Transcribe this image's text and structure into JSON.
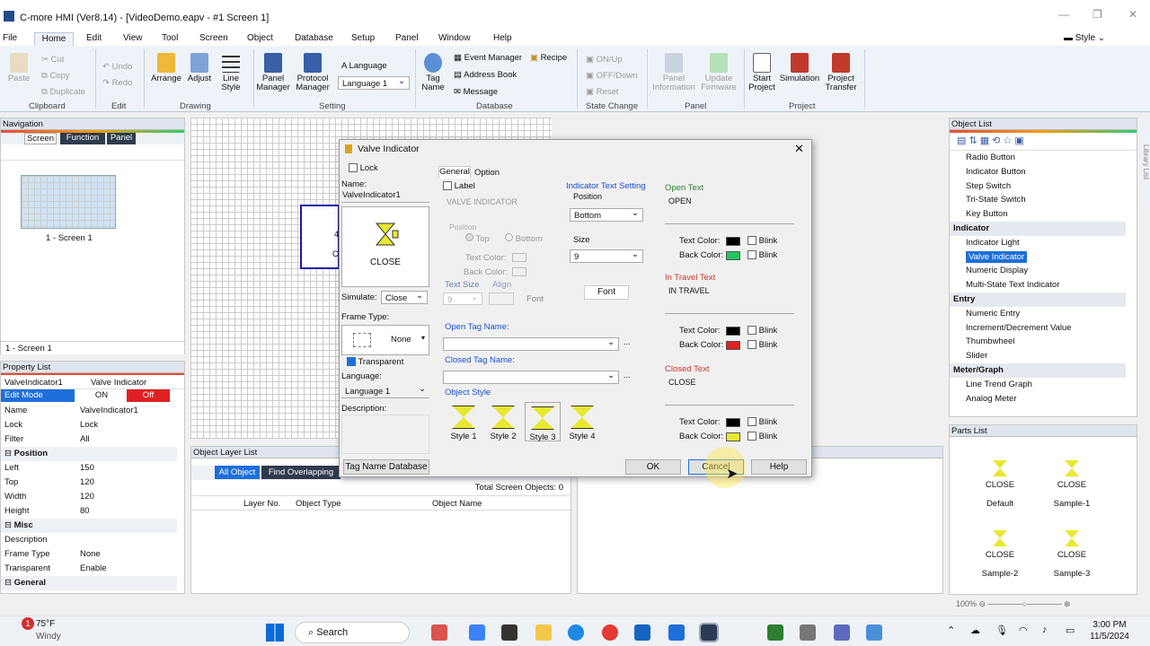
{
  "window": {
    "title": "C-more HMI (Ver8.14) - [VideoDemo.eapv - #1 Screen 1]",
    "min": "—",
    "max": "❐",
    "close": "✕"
  },
  "menu": [
    "File",
    "Home",
    "Edit",
    "View",
    "Tool",
    "Screen",
    "Object",
    "Database",
    "Setup",
    "Panel",
    "Window",
    "Help"
  ],
  "style_label": "Style",
  "ribbon": {
    "clipboard": {
      "paste": "Paste",
      "cut": "Cut",
      "copy": "Copy",
      "duplicate": "Duplicate",
      "group": "Clipboard"
    },
    "edit": {
      "undo": "Undo",
      "redo": "Redo",
      "group": "Edit"
    },
    "drawing": {
      "arrange": "Arrange",
      "adjust": "Adjust",
      "line_style": "Line Style",
      "group": "Drawing"
    },
    "setting": {
      "panel_manager": "Panel Manager",
      "protocol_manager": "Protocol Manager",
      "language": "Language",
      "language_value": "Language 1",
      "group": "Setting"
    },
    "database": {
      "tag_name": "Tag Name",
      "event_manager": "Event Manager",
      "address_book": "Address Book",
      "message": "Message",
      "recipe": "Recipe",
      "group": "Database"
    },
    "state_change": {
      "on_up": "ON/Up",
      "off_down": "OFF/Down",
      "reset": "Reset",
      "group": "State Change"
    },
    "panel": {
      "panel_information": "Panel Information",
      "update_firmware": "Update Firmware",
      "group": "Panel"
    },
    "project": {
      "start_project": "Start Project",
      "simulation": "Simulation",
      "project_transfer": "Project Transfer",
      "group": "Project"
    }
  },
  "navigation": {
    "title": "Navigation",
    "tabs": [
      "Screen",
      "Function",
      "Panel"
    ],
    "thumb_label": "1 - Screen 1",
    "current": "1 - Screen 1"
  },
  "property_list": {
    "title": "Property List",
    "object": "ValveIndicator1",
    "type": "Valve Indicator",
    "edit_mode": "Edit Mode",
    "on": "ON",
    "off": "Off",
    "rows": [
      [
        "Name",
        "ValveIndicator1"
      ],
      [
        "Lock",
        "Lock"
      ],
      [
        "Filter",
        "All"
      ]
    ],
    "position_header": "Position",
    "position": [
      [
        "Left",
        "150"
      ],
      [
        "Top",
        "120"
      ],
      [
        "Width",
        "120"
      ],
      [
        "Height",
        "80"
      ]
    ],
    "misc_header": "Misc",
    "misc": [
      [
        "Description",
        ""
      ],
      [
        "Frame Type",
        "None"
      ],
      [
        "Transparent",
        "Enable"
      ]
    ],
    "general": "General"
  },
  "object_layer": {
    "title": "Object Layer List",
    "tabs": [
      "All Object",
      "Find Overlapping"
    ],
    "total": "Total Screen Objects: 0",
    "cols": [
      "Layer No.",
      "Object Type",
      "Object Name"
    ]
  },
  "object_list": {
    "title": "Object List",
    "items": [
      {
        "label": "Radio Button",
        "h": false
      },
      {
        "label": "Indicator Button",
        "h": false
      },
      {
        "label": "Step Switch",
        "h": false
      },
      {
        "label": "Tri-State Switch",
        "h": false
      },
      {
        "label": "Key Button",
        "h": false
      },
      {
        "label": "Indicator",
        "h": true
      },
      {
        "label": "Indicator Light",
        "h": false
      },
      {
        "label": "Valve Indicator",
        "h": false,
        "sel": true
      },
      {
        "label": "Numeric Display",
        "h": false
      },
      {
        "label": "Multi-State Text Indicator",
        "h": false
      },
      {
        "label": "Entry",
        "h": true
      },
      {
        "label": "Numeric Entry",
        "h": false
      },
      {
        "label": "Increment/Decrement Value",
        "h": false
      },
      {
        "label": "Thumbwheel",
        "h": false
      },
      {
        "label": "Slider",
        "h": false
      },
      {
        "label": "Meter/Graph",
        "h": true
      },
      {
        "label": "Line Trend Graph",
        "h": false
      },
      {
        "label": "Analog Meter",
        "h": false
      }
    ]
  },
  "side_tab": "Library List",
  "parts_list": {
    "title": "Parts List",
    "items": [
      {
        "text": "CLOSE",
        "label": "Default"
      },
      {
        "text": "CLOSE",
        "label": "Sample-1"
      },
      {
        "text": "CLOSE",
        "label": "Sample-2"
      },
      {
        "text": "CLOSE",
        "label": "Sample-3"
      }
    ]
  },
  "dialog": {
    "title": "Valve Indicator",
    "lock": "Lock",
    "name_label": "Name:",
    "name_value": "ValveIndicator1",
    "preview_text": "CLOSE",
    "simulate_label": "Simulate:",
    "simulate_value": "Close",
    "frame_type_label": "Frame Type:",
    "frame_value": "None",
    "transparent": "Transparent",
    "language_label": "Language:",
    "language_value": "Language 1",
    "description_label": "Description:",
    "tag_db_button": "Tag Name Database",
    "tabs": [
      "General",
      "Option"
    ],
    "label_chk": "Label",
    "label_value": "VALVE INDICATOR",
    "position_label": "Position",
    "top": "Top",
    "bottom": "Bottom",
    "text_color": "Text Color:",
    "back_color": "Back Color:",
    "text_size": "Text Size",
    "align": "Align",
    "text_size_value": "9",
    "font": "Font",
    "indicator_text_setting": "Indicator Text Setting",
    "its_position_label": "Position",
    "its_position_value": "Bottom",
    "size_label": "Size",
    "size_value": "9",
    "font_button": "Font",
    "open_tag": "Open Tag Name:",
    "closed_tag": "Closed Tag Name:",
    "object_style": "Object Style",
    "styles": [
      "Style 1",
      "Style 2",
      "Style 3",
      "Style 4"
    ],
    "open_text_label": "Open Text",
    "open_text": "OPEN",
    "in_travel_label": "In Travel Text",
    "in_travel_text": "IN TRAVEL",
    "closed_text_label": "Closed Text",
    "closed_text": "CLOSE",
    "blink": "Blink",
    "ok": "OK",
    "cancel": "Cancel",
    "help": "Help",
    "colors": {
      "open_back": "#22c55e",
      "travel_back": "#e02020",
      "closed_back": "#e8e830",
      "text": "#000000"
    }
  },
  "canvas_fragments": [
    "4",
    "C"
  ],
  "taskbar": {
    "temp": "75°F",
    "weather": "Windy",
    "search": "Search",
    "time": "3:00 PM",
    "date": "11/5/2024",
    "badge": "1"
  }
}
